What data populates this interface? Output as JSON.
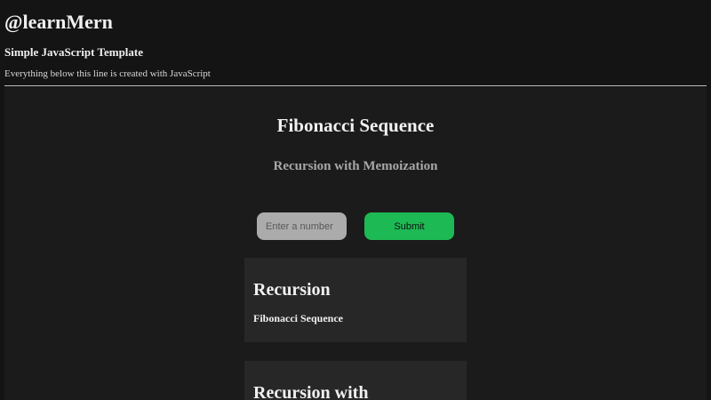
{
  "header": {
    "brand": "@learnMern",
    "subtitle": "Simple JavaScript Template",
    "note": "Everything below this line is created with JavaScript"
  },
  "app": {
    "title": "Fibonacci Sequence",
    "subtitle": "Recursion with Memoization",
    "input": {
      "placeholder": "Enter a number",
      "value": ""
    },
    "submit_label": "Submit",
    "cards": [
      {
        "heading": "Recursion",
        "label": "Fibonacci Sequence"
      },
      {
        "heading": "Recursion with"
      }
    ]
  },
  "colors": {
    "background": "#141414",
    "panel": "#1b1b1b",
    "card": "#272727",
    "accent": "#1db954",
    "input": "#ababab"
  }
}
